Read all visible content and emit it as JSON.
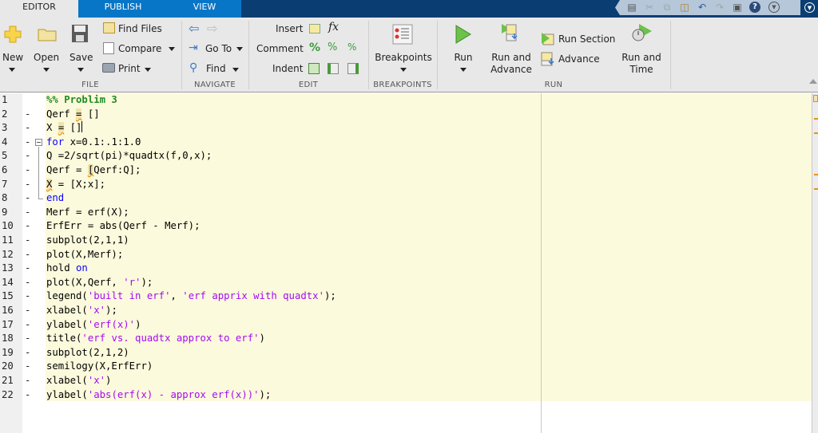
{
  "tabs": [
    {
      "label": "EDITOR",
      "active": true
    },
    {
      "label": "PUBLISH",
      "active": false
    },
    {
      "label": "VIEW",
      "active": false
    }
  ],
  "quick_access": {
    "icons": [
      "save-icon",
      "cut-icon",
      "copy-icon",
      "paste-icon",
      "undo-icon",
      "redo-icon",
      "switch-windows-icon",
      "help-icon",
      "customize-icon",
      "minimize-toolstrip-icon"
    ]
  },
  "ribbon": {
    "file": {
      "section_label": "FILE",
      "new_label": "New",
      "open_label": "Open",
      "save_label": "Save",
      "find_files_label": "Find Files",
      "compare_label": "Compare",
      "print_label": "Print"
    },
    "navigate": {
      "section_label": "NAVIGATE",
      "go_to_label": "Go To",
      "find_label": "Find"
    },
    "edit": {
      "section_label": "EDIT",
      "insert_label": "Insert",
      "fx_label": "fx",
      "comment_label": "Comment",
      "comment_glyph": "%",
      "indent_label": "Indent"
    },
    "breakpoints": {
      "section_label": "BREAKPOINTS",
      "breakpoints_label": "Breakpoints"
    },
    "run": {
      "section_label": "RUN",
      "run_label": "Run",
      "run_and_advance_line1": "Run and",
      "run_and_advance_line2": "Advance",
      "run_section_label": "Run Section",
      "advance_label": "Advance",
      "run_and_time_line1": "Run and",
      "run_and_time_line2": "Time"
    }
  },
  "editor": {
    "lines": [
      {
        "n": "1",
        "dash": "",
        "code": "%% Problim 3"
      },
      {
        "n": "2",
        "dash": "-",
        "code": "Qerf = []"
      },
      {
        "n": "3",
        "dash": "-",
        "code": "X = []"
      },
      {
        "n": "4",
        "dash": "-",
        "code": "for x=0.1:.1:1.0"
      },
      {
        "n": "5",
        "dash": "-",
        "code": "Q =2/sqrt(pi)*quadtx(f,0,x);"
      },
      {
        "n": "6",
        "dash": "-",
        "code": "Qerf = [Qerf:Q];"
      },
      {
        "n": "7",
        "dash": "-",
        "code": "X = [X;x];"
      },
      {
        "n": "8",
        "dash": "-",
        "code": "end"
      },
      {
        "n": "9",
        "dash": "-",
        "code": "Merf = erf(X);"
      },
      {
        "n": "10",
        "dash": "-",
        "code": "ErfErr = abs(Qerf - Merf);"
      },
      {
        "n": "11",
        "dash": "-",
        "code": "subplot(2,1,1)"
      },
      {
        "n": "12",
        "dash": "-",
        "code": "plot(X,Merf);"
      },
      {
        "n": "13",
        "dash": "-",
        "code": "hold on"
      },
      {
        "n": "14",
        "dash": "-",
        "code": "plot(X,Qerf, 'r');"
      },
      {
        "n": "15",
        "dash": "-",
        "code": "legend('built in erf', 'erf apprix with quadtx');"
      },
      {
        "n": "16",
        "dash": "-",
        "code": "xlabel('x');"
      },
      {
        "n": "17",
        "dash": "-",
        "code": "ylabel('erf(x)')"
      },
      {
        "n": "18",
        "dash": "-",
        "code": "title('erf vs. quadtx approx to erf')"
      },
      {
        "n": "19",
        "dash": "-",
        "code": "subplot(2,1,2)"
      },
      {
        "n": "20",
        "dash": "-",
        "code": "semilogy(X,ErfErr)"
      },
      {
        "n": "21",
        "dash": "-",
        "code": "xlabel('x')"
      },
      {
        "n": "22",
        "dash": "-",
        "code": "ylabel('abs(erf(x) - approx erf(x))');"
      }
    ]
  },
  "colors": {
    "keyword": "#0e00ff",
    "string": "#a709f5",
    "comment": "#228b22",
    "warning": "#f0900a",
    "cell_highlight": "#fbfadc",
    "tab_active_bg": "#0876c7",
    "tab_strip_bg": "#0a3d72"
  }
}
